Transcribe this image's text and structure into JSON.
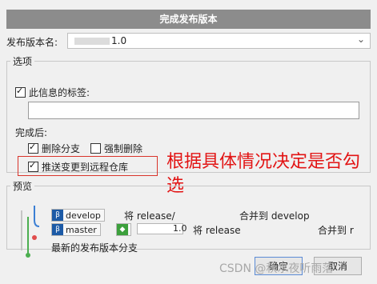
{
  "dialog": {
    "title": "完成发布版本"
  },
  "version": {
    "label": "发布版本名:",
    "value": "1.0"
  },
  "options": {
    "legend": "选项",
    "tag_message": {
      "label": "此信息的标签:",
      "checked": true,
      "value": ""
    },
    "after_finish_label": "完成后:",
    "delete_branch": {
      "label": "删除分支",
      "checked": true
    },
    "force_delete": {
      "label": "强制删除",
      "checked": false
    },
    "push_remote": {
      "label": "推送变更到远程仓库",
      "checked": true
    }
  },
  "annotation": {
    "text": "根据具体情况决定是否勾选",
    "color": "#e21414"
  },
  "preview": {
    "legend": "预览",
    "row1": {
      "branch": "develop",
      "text_a": "将 release/",
      "text_b": "合并到 develop"
    },
    "row2": {
      "branch": "master",
      "tag_value": "1.0",
      "text_a": "将 release",
      "text_b": "合并到 r"
    },
    "row3": {
      "text": "最新的发布版本分支"
    },
    "colors": {
      "develop_line": "#3b7fd4",
      "master_line": "#4caf50",
      "release_dot": "#e04c4c"
    }
  },
  "buttons": {
    "ok": "确定",
    "cancel": "取消"
  },
  "watermark": "CSDN @秋水夜听雨落"
}
